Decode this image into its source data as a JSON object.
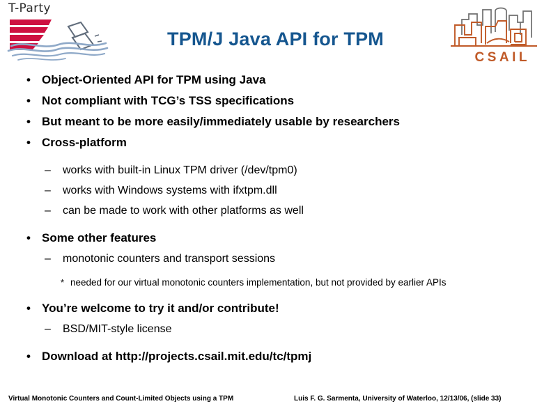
{
  "branding": {
    "tparty_wordmark": "T-Party",
    "tparty_logo_name": "t-party-logo",
    "csail_wordmark": "C S A I L",
    "colors": {
      "tparty_red": "#CE1141",
      "tparty_wave_blue": "#8FA9C8",
      "csail_orange": "#C05A28",
      "csail_gray": "#6E6E6E",
      "title_blue": "#15568F"
    }
  },
  "title": "TPM/J Java API for TPM",
  "bullets": [
    {
      "level": 1,
      "marker": "•",
      "text": "Object-Oriented API for TPM using Java"
    },
    {
      "level": 1,
      "marker": "•",
      "text": "Not compliant with TCG’s TSS specifications"
    },
    {
      "level": 1,
      "marker": "•",
      "text": "But meant to be more easily/immediately usable by researchers"
    },
    {
      "level": 1,
      "marker": "•",
      "text": "Cross-platform"
    },
    {
      "level": 2,
      "marker": "–",
      "text": "works with built-in Linux TPM driver (/dev/tpm0)"
    },
    {
      "level": 2,
      "marker": "–",
      "text": "works with Windows systems with ifxtpm.dll"
    },
    {
      "level": 2,
      "marker": "–",
      "text": "can be made to work with other platforms as well"
    },
    {
      "level": 1,
      "marker": "•",
      "text": "Some other features"
    },
    {
      "level": 2,
      "marker": "–",
      "text": "monotonic counters and transport sessions"
    },
    {
      "level": 3,
      "marker": "*",
      "text": "needed for our virtual monotonic counters implementation, but not provided by earlier APIs"
    },
    {
      "level": 1,
      "marker": "•",
      "text": "You’re welcome to try it and/or contribute!"
    },
    {
      "level": 2,
      "marker": "–",
      "text": "BSD/MIT-style license"
    },
    {
      "level": 1,
      "marker": "•",
      "text": "Download at http://projects.csail.mit.edu/tc/tpmj"
    }
  ],
  "footer": {
    "left": "Virtual Monotonic Counters and Count-Limited Objects using a TPM",
    "right": "Luis F. G. Sarmenta, University of Waterloo, 12/13/06, (slide 33)"
  }
}
